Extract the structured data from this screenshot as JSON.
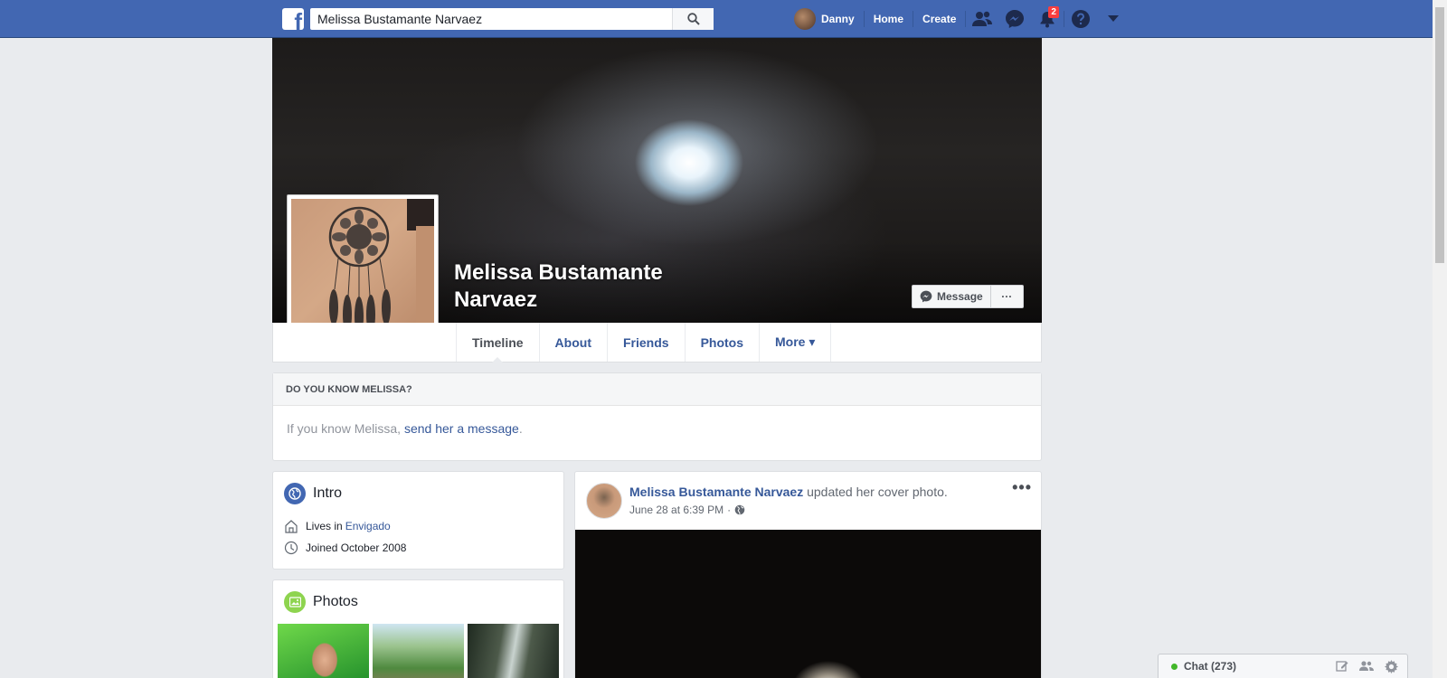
{
  "topbar": {
    "brand_icon": "facebook-logo",
    "search_value": "Melissa Bustamante Narvaez",
    "user_name": "Danny",
    "home_label": "Home",
    "create_label": "Create",
    "notifications_count": "2",
    "icons": [
      "friend-requests-icon",
      "messenger-icon",
      "notifications-icon",
      "help-icon",
      "account-menu-chevron-icon"
    ],
    "brand_color": "#4267b2"
  },
  "profile": {
    "name": "Melissa Bustamante Narvaez",
    "message_button": "Message",
    "more_button": "···"
  },
  "tabs": [
    {
      "label": "Timeline",
      "active": true
    },
    {
      "label": "About"
    },
    {
      "label": "Friends"
    },
    {
      "label": "Photos"
    },
    {
      "label": "More ▾"
    }
  ],
  "know_card": {
    "heading": "DO YOU KNOW MELISSA?",
    "text_prefix": "If you know Melissa,",
    "link": "send her a message",
    "text_suffix": "."
  },
  "intro": {
    "title": "Intro",
    "lives_prefix": "Lives in",
    "lives_place": "Envigado",
    "joined": "Joined October 2008"
  },
  "photos": {
    "title": "Photos"
  },
  "post": {
    "author": "Melissa Bustamante Narvaez",
    "action": "updated her cover photo.",
    "timestamp": "June 28 at 6:39 PM",
    "separator": "·",
    "menu": "•••"
  },
  "chat": {
    "label": "Chat (273)"
  }
}
